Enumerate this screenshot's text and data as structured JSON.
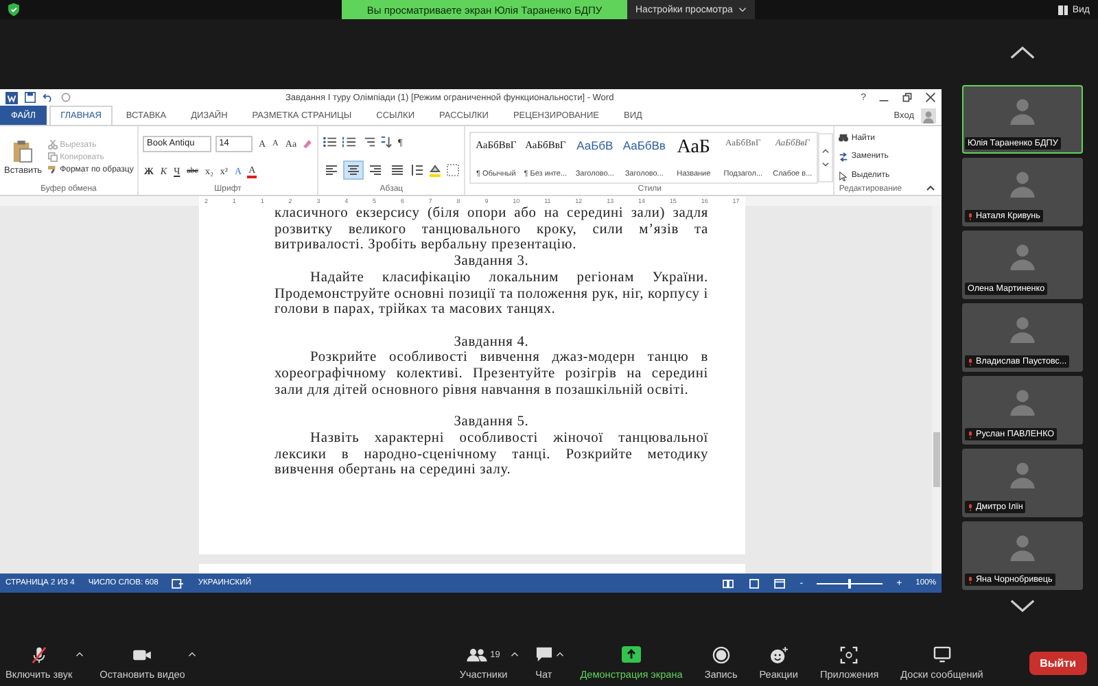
{
  "top_bar": {
    "banner": "Вы просматриваете экран Юлія Тараненко БДПУ",
    "view_settings": "Настройки просмотра",
    "view": "Вид"
  },
  "word": {
    "title": "Завдання І туру Олімпіади (1) [Режим ограниченной функциональности] - Word",
    "help": "?",
    "user": "Вход",
    "tabs": [
      {
        "label": "ФАЙЛ",
        "kind": "file",
        "selected": false
      },
      {
        "label": "ГЛАВНАЯ",
        "kind": "tab",
        "selected": true
      },
      {
        "label": "ВСТАВКА",
        "kind": "tab",
        "selected": false
      },
      {
        "label": "ДИЗАЙН",
        "kind": "tab",
        "selected": false
      },
      {
        "label": "РАЗМЕТКА СТРАНИЦЫ",
        "kind": "tab",
        "selected": false
      },
      {
        "label": "ССЫЛКИ",
        "kind": "tab",
        "selected": false
      },
      {
        "label": "РАССЫЛКИ",
        "kind": "tab",
        "selected": false
      },
      {
        "label": "РЕЦЕНЗИРОВАНИЕ",
        "kind": "tab",
        "selected": false
      },
      {
        "label": "ВИД",
        "kind": "tab",
        "selected": false
      }
    ],
    "clipboard": {
      "label": "Буфер обмена",
      "paste": "Вставить",
      "items": [
        {
          "label": "Вырезать",
          "kind": "cut",
          "disabled": true
        },
        {
          "label": "Копировать",
          "kind": "copy",
          "disabled": true
        },
        {
          "label": "Формат по образцу",
          "kind": "painter",
          "disabled": false
        }
      ]
    },
    "font": {
      "label": "Шрифт",
      "name": "Book Antiqu",
      "size": "14",
      "size_buttons": [
        {
          "label": "A",
          "kind": "grow"
        },
        {
          "label": "A",
          "kind": "shrink"
        },
        {
          "label": "Aa",
          "kind": "case"
        }
      ],
      "format_buttons": [
        {
          "label": "Ж",
          "kind": "bold"
        },
        {
          "label": "К",
          "kind": "italic"
        },
        {
          "label": "Ч",
          "kind": "underline"
        },
        {
          "label": "abc",
          "kind": "strike"
        },
        {
          "label": "x₂",
          "kind": "sub"
        },
        {
          "label": "x²",
          "kind": "sup"
        },
        {
          "label": "A",
          "kind": "effects"
        },
        {
          "label": "A",
          "kind": "color"
        }
      ]
    },
    "paragraph": {
      "label": "Абзац",
      "pilcrow": "¶",
      "alignment": [
        {
          "kind": "left",
          "selected": false
        },
        {
          "kind": "center",
          "selected": true
        },
        {
          "kind": "right",
          "selected": false
        },
        {
          "kind": "justify",
          "selected": false
        }
      ]
    },
    "styles": {
      "label": "Стили",
      "items": [
        {
          "sample": "АаБбВвГ",
          "name": "¶ Обычный",
          "kind": "normal"
        },
        {
          "sample": "АаБбВвГ",
          "name": "¶ Без инте...",
          "kind": "normal"
        },
        {
          "sample": "АаБбВ",
          "name": "Заголово...",
          "kind": "heading"
        },
        {
          "sample": "АаБбВв",
          "name": "Заголово...",
          "kind": "heading"
        },
        {
          "sample": "АаБ",
          "name": "Название",
          "kind": "title"
        },
        {
          "sample": "АаБбВвГ",
          "name": "Подзагол...",
          "kind": "subtitle"
        },
        {
          "sample": "АаБбВвГ",
          "name": "Слабое в...",
          "kind": "emphasis"
        }
      ]
    },
    "editing": {
      "label": "Редактирование",
      "items": [
        {
          "label": "Найти",
          "kind": "find"
        },
        {
          "label": "Заменить",
          "kind": "replace"
        },
        {
          "label": "Выделить",
          "kind": "select"
        }
      ]
    },
    "ruler": [
      "2",
      "1",
      "1",
      "2",
      "3",
      "4",
      "5",
      "6",
      "7",
      "8",
      "9",
      "10",
      "11",
      "12",
      "13",
      "14",
      "15",
      "16",
      "17"
    ],
    "document": [
      {
        "kind": "continuation",
        "text": "класичного екзерсису (біля опори або на середині зали) задля розвитку великого танцювального кроку, сили м’язів та витривалості. Зробіть вербальну презентацію."
      },
      {
        "kind": "heading",
        "text": "Завдання 3."
      },
      {
        "kind": "body",
        "text": "Надайте класифікацію локальним регіонам України. Продемонструйте основні позиції та положення рук, ніг, корпусу і голови в парах, трійках та масових танцях."
      },
      {
        "kind": "heading_spaced",
        "text": "Завдання 4."
      },
      {
        "kind": "body",
        "text": "Розкрийте особливості вивчення джаз-модерн танцю в хореографічному колективі. Презентуйте розігрів на середині зали для дітей основного рівня навчання в позашкільній освіті."
      },
      {
        "kind": "heading_spaced",
        "text": "Завдання 5."
      },
      {
        "kind": "body",
        "text": "Назвіть характерні особливості жіночої танцювальної лексики в народно-сценічному танці. Розкрийте методику вивчення обертань на середині залу."
      }
    ],
    "status_bar": {
      "page": "СТРАНИЦА 2 ИЗ 4",
      "words": "ЧИСЛО СЛОВ: 608",
      "language": "УКРАИНСКИЙ",
      "zoom_out": "-",
      "zoom_in": "+",
      "zoom": "100%",
      "level": 0.5
    }
  },
  "participants": [
    {
      "name": "Юлія Тараненко БДПУ",
      "muted": false,
      "active": true
    },
    {
      "name": "Наталя Кривунь",
      "muted": true,
      "active": false
    },
    {
      "name": "Олена Мартиненко",
      "muted": false,
      "active": false
    },
    {
      "name": "Владислав Паустовс...",
      "muted": true,
      "active": false
    },
    {
      "name": "Руслан ПАВЛЕНКО",
      "muted": true,
      "active": false
    },
    {
      "name": "Дмитро Ілїн",
      "muted": true,
      "active": false
    },
    {
      "name": "Яна Чорнобривець",
      "muted": true,
      "active": false
    }
  ],
  "toolbar": [
    {
      "label": "Включить звук",
      "kind": "mic",
      "caret": true
    },
    {
      "label": "Остановить видео",
      "kind": "video",
      "caret": true
    },
    {
      "label": "Участники",
      "kind": "participants",
      "count": "19",
      "caret": true
    },
    {
      "label": "Чат",
      "kind": "chat",
      "caret": true
    },
    {
      "label": "Демонстрация экрана",
      "kind": "share",
      "caret": false
    },
    {
      "label": "Запись",
      "kind": "record",
      "caret": false
    },
    {
      "label": "Реакции",
      "kind": "reactions",
      "caret": false
    },
    {
      "label": "Приложения",
      "kind": "apps",
      "caret": false
    },
    {
      "label": "Доски сообщений",
      "kind": "whiteboard",
      "caret": false
    }
  ],
  "leave": "Выйти"
}
